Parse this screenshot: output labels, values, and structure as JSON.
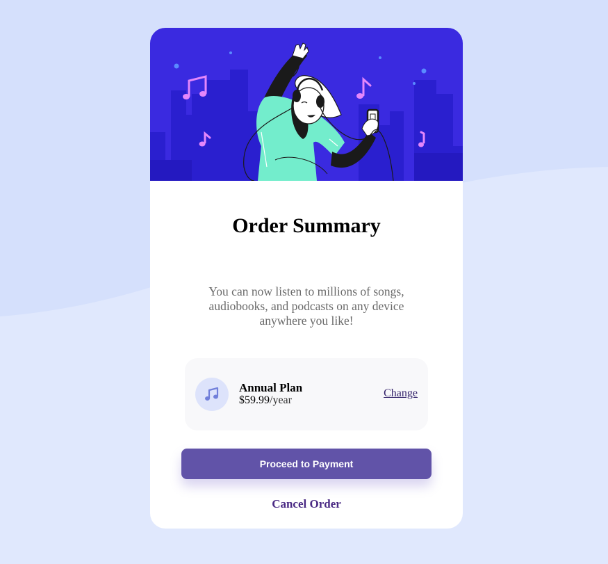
{
  "colors": {
    "page_background": "#e0e8fd",
    "wave": "#d5e0fc",
    "hero_background": "#3a2ae0",
    "primary_button": "#6153a8",
    "link": "#34236b"
  },
  "hero": {
    "illustration": "person-dancing-with-headphones-illustration"
  },
  "title": "Order Summary",
  "description": "You can now listen to millions of songs, audiobooks, and podcasts on any device anywhere you like!",
  "plan": {
    "icon": "music-note-icon",
    "name": "Annual Plan",
    "price": "$59.99",
    "period": "/year",
    "change_label": "Change"
  },
  "actions": {
    "proceed_label": "Proceed to Payment",
    "cancel_label": "Cancel Order"
  }
}
